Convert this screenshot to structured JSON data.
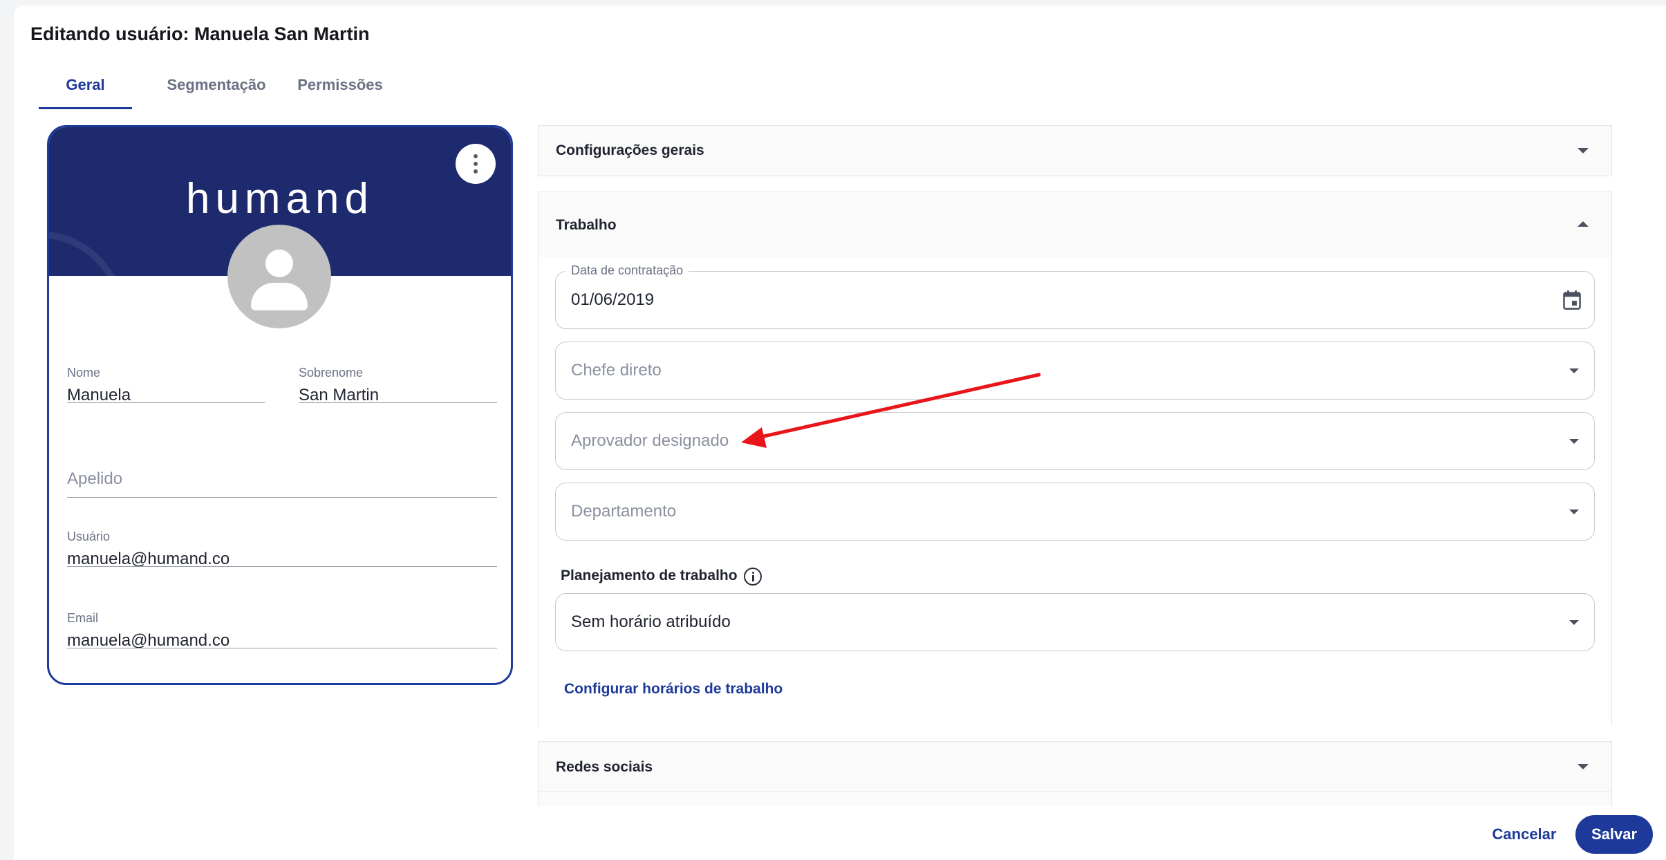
{
  "dialog": {
    "title": "Editando usuário: Manuela San Martin"
  },
  "tabs": [
    {
      "label": "Geral",
      "active": true
    },
    {
      "label": "Segmentação",
      "active": false
    },
    {
      "label": "Permissões",
      "active": false
    }
  ],
  "profile_card": {
    "logo_text": "humand",
    "fields": {
      "nome": {
        "label": "Nome",
        "value": "Manuela"
      },
      "sobrenome": {
        "label": "Sobrenome",
        "value": "San Martin"
      },
      "apelido": {
        "placeholder": "Apelido"
      },
      "usuario": {
        "label": "Usuário",
        "value": "manuela@humand.co"
      },
      "email": {
        "label": "Email",
        "value": "manuela@humand.co"
      }
    },
    "icons": [
      "more-vert-icon",
      "avatar-placeholder-icon"
    ]
  },
  "sections": {
    "configuracoes_gerais": {
      "title": "Configurações gerais",
      "expanded": false
    },
    "trabalho": {
      "title": "Trabalho",
      "expanded": true,
      "data_contratacao": {
        "label": "Data de contratação",
        "value": "01/06/2019"
      },
      "chefe_direto": {
        "placeholder": "Chefe direto"
      },
      "aprovador_designado": {
        "placeholder": "Aprovador designado"
      },
      "departamento": {
        "placeholder": "Departamento"
      },
      "planejamento_label": "Planejamento de trabalho",
      "planejamento_value": "Sem horário atribuído",
      "configurar_link": "Configurar horários de trabalho"
    },
    "redes_sociais": {
      "title": "Redes sociais",
      "expanded": false
    }
  },
  "footer": {
    "cancel_label": "Cancelar",
    "save_label": "Salvar"
  },
  "colors": {
    "primary": "#1d3a9a",
    "banner": "#1e2a6e",
    "annotation_arrow": "#e8161b"
  }
}
